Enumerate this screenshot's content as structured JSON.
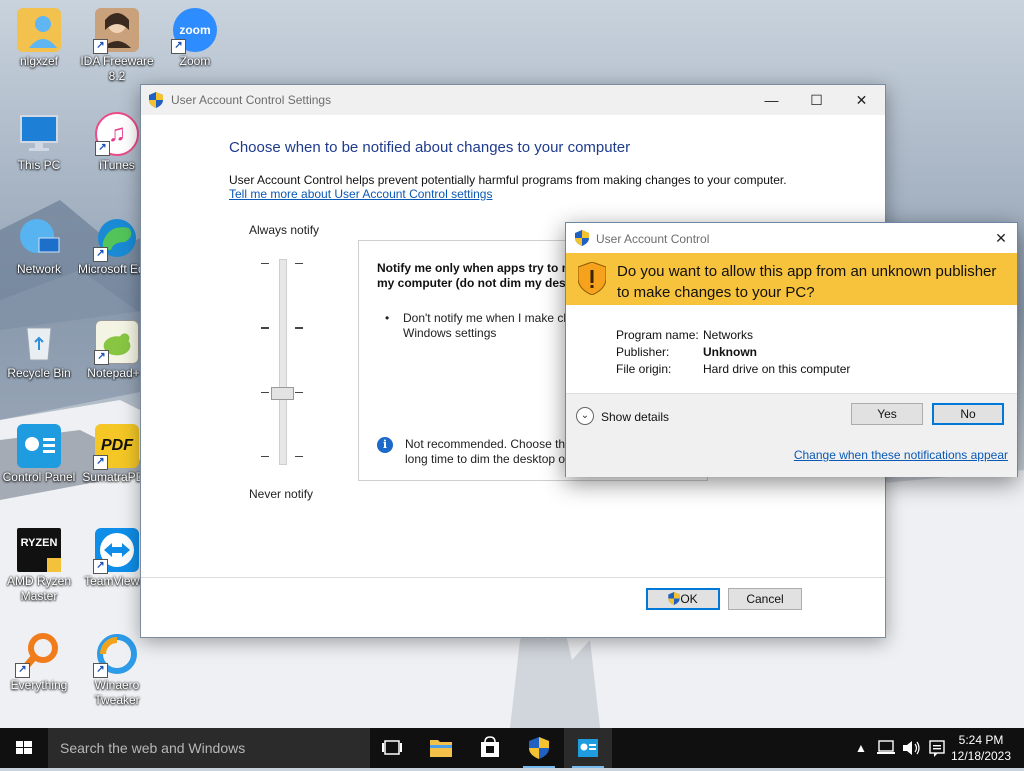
{
  "desktop": {
    "icons": [
      {
        "label": "nlgxzef"
      },
      {
        "label": "IDA Freeware 8.2"
      },
      {
        "label": "Zoom",
        "logo_text": "zoom"
      },
      {
        "label": "This PC"
      },
      {
        "label": "iTunes"
      },
      {
        "label": "Network"
      },
      {
        "label": "Microsoft Edge"
      },
      {
        "label": "Recycle Bin"
      },
      {
        "label": "Notepad++"
      },
      {
        "label": "Control Panel"
      },
      {
        "label": "SumatraPDF",
        "logo_text": "PDF"
      },
      {
        "label": "AMD Ryzen Master",
        "logo_text": "RYZEN"
      },
      {
        "label": "TeamViewer"
      },
      {
        "label": "Everything"
      },
      {
        "label": "Winaero Tweaker"
      }
    ]
  },
  "uac_settings": {
    "title": "User Account Control Settings",
    "heading": "Choose when to be notified about changes to your computer",
    "description": "User Account Control helps prevent potentially harmful programs from making changes to your computer.",
    "learn_more_link": "Tell me more about User Account Control settings",
    "always_notify": "Always notify",
    "never_notify": "Never notify",
    "slider_level": "3 of 4",
    "box_header": "Notify me only when apps try to make changes to my computer (do not dim my desktop)",
    "box_bullet": "Don't notify me when I make changes to Windows settings",
    "box_note": "Not recommended. Choose this only if it takes a long time to dim the desktop on your computer.",
    "ok_label": "OK",
    "cancel_label": "Cancel"
  },
  "uac_prompt": {
    "title": "User Account Control",
    "question": "Do you want to allow this app from an unknown publisher to make changes to your PC?",
    "program_name_label": "Program name:",
    "program_name": "Networks",
    "publisher_label": "Publisher:",
    "publisher": "Unknown",
    "file_origin_label": "File origin:",
    "file_origin": "Hard drive on this computer",
    "show_details": "Show details",
    "yes_label": "Yes",
    "no_label": "No",
    "change_link": "Change when these notifications appear",
    "banner_color": "#f7c23c"
  },
  "taskbar": {
    "search_placeholder": "Search the web and Windows",
    "time": "5:24 PM",
    "date": "12/18/2023"
  }
}
